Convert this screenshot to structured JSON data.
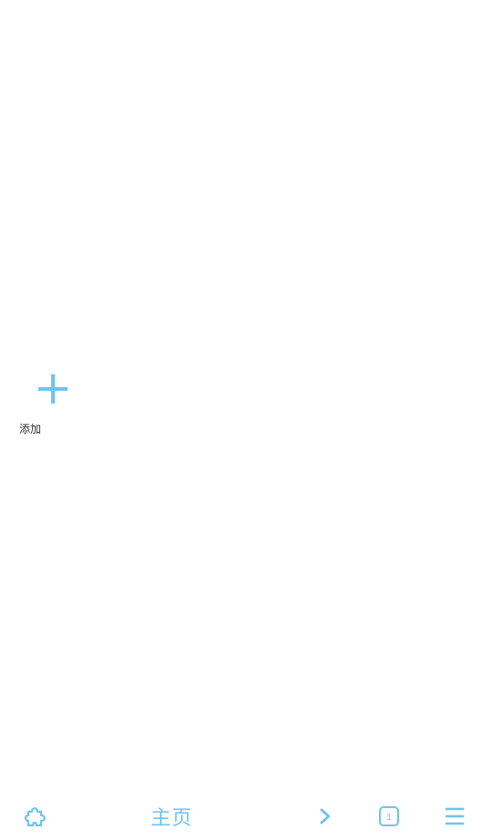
{
  "shortcuts": {
    "add_label": "添加"
  },
  "bottom_bar": {
    "home_label": "主页",
    "tab_count": "1"
  },
  "theme": {
    "accent": "#6fc3ec",
    "label_text": "#333333",
    "background": "#ffffff"
  },
  "icons": {
    "add": "plus-icon",
    "extensions": "puzzle-icon",
    "forward": "chevron-right-icon",
    "tabs": "tab-counter-icon",
    "menu": "hamburger-menu-icon"
  }
}
